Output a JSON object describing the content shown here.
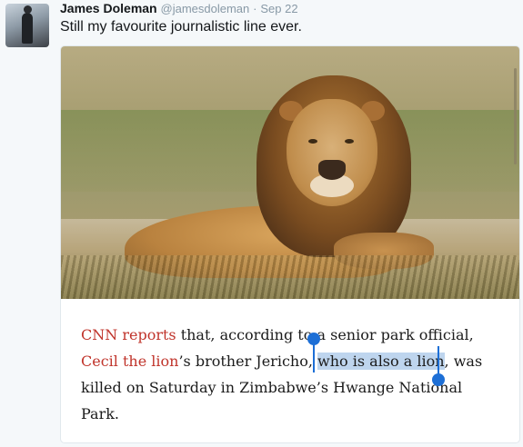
{
  "tweet": {
    "author_name": "James Doleman",
    "handle": "@jamesdoleman",
    "separator": "·",
    "date": "Sep 22",
    "text": "Still my favourite journalistic line ever."
  },
  "article": {
    "line1": {
      "link": "CNN reports",
      "text_a": " that, according to",
      "text_b": "a",
      "text_c": " senior park official,"
    },
    "line2": {
      "link": "Cecil the lion",
      "text_a": "’s brother Jericho, ",
      "selected": "who is also a lion",
      "text_b": ", was"
    },
    "line3": "killed on Saturday in Zimbabwe’s Hwange National",
    "line4": "Park."
  },
  "colors": {
    "link": "#c0342b",
    "selection": "#bed5ee",
    "selection_handle": "#1d6fd6"
  }
}
